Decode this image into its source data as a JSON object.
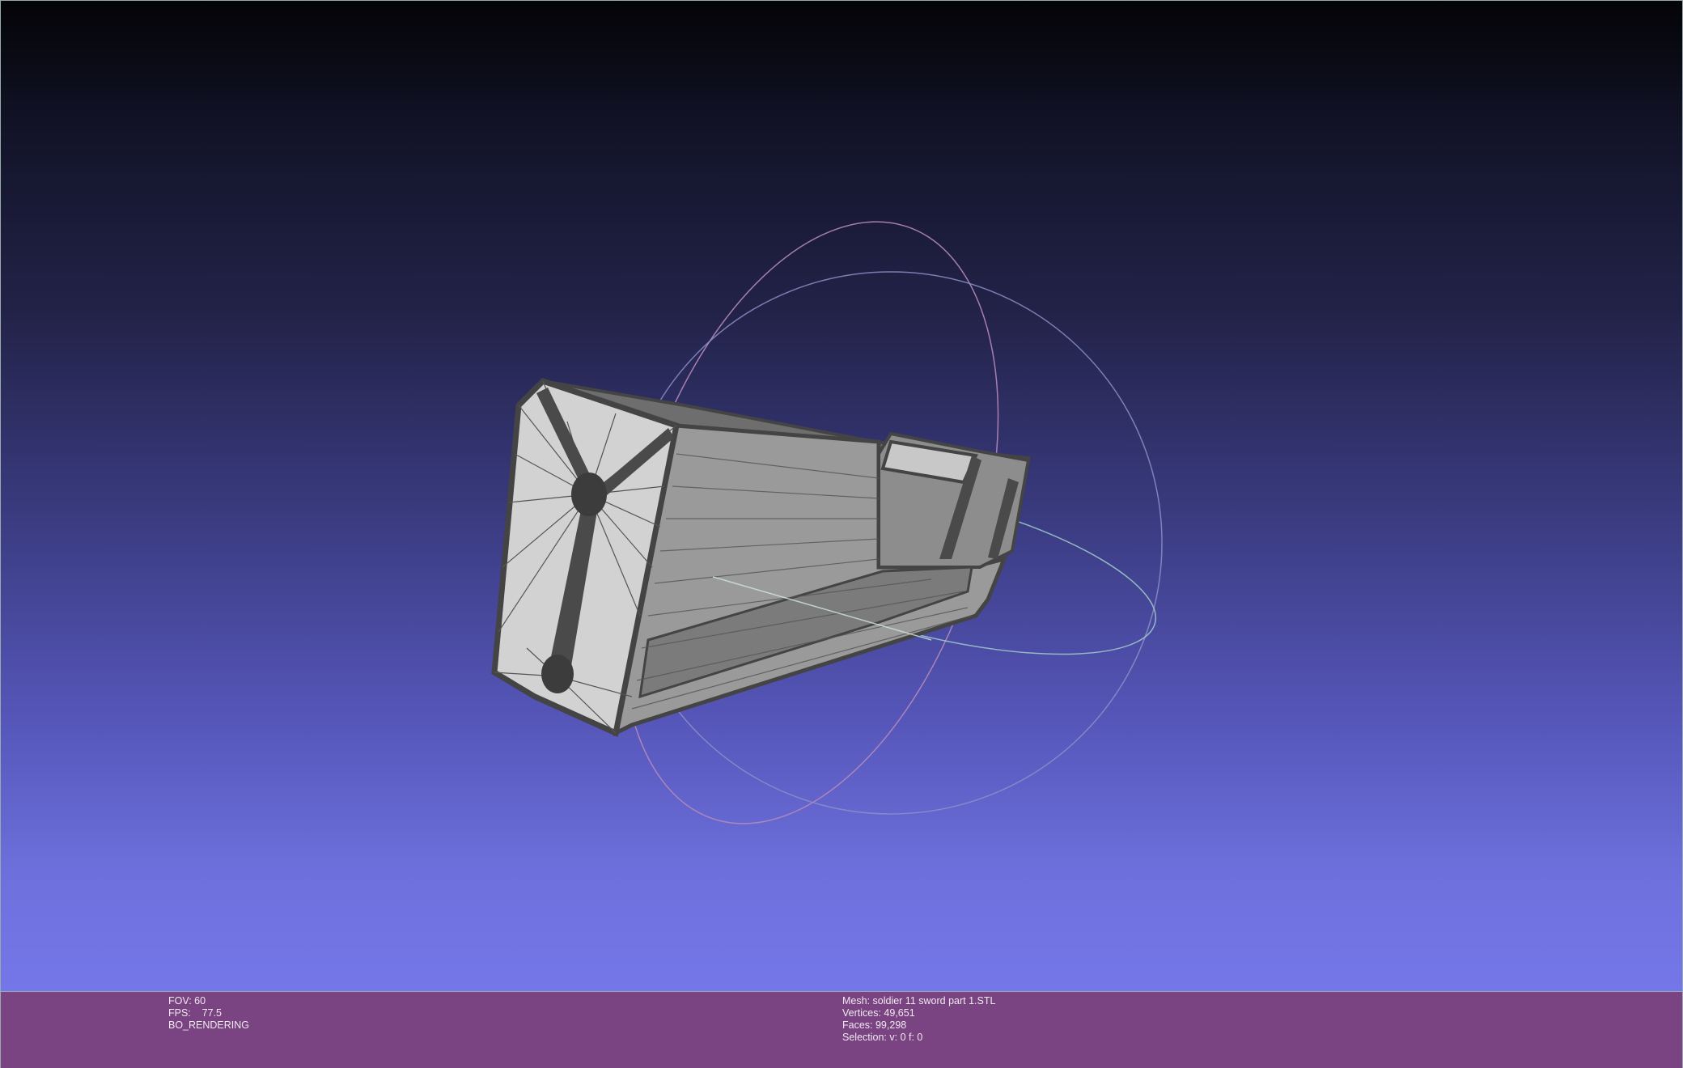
{
  "left_info": {
    "fov": "FOV: 60",
    "fps": "FPS:    77.5",
    "mode": "BO_RENDERING"
  },
  "right_info": {
    "mesh": "Mesh: soldier 11 sword part 1.STL",
    "vertices": "Vertices: 49,651",
    "faces": "Faces: 99,298",
    "selection": "Selection: v: 0 f: 0"
  },
  "colors": {
    "background_top": "#040407",
    "background_bottom": "#7477e8",
    "infobar": "#7a4482",
    "mesh_face_light": "#cfcfcf",
    "mesh_face_dark": "#8e8e8e",
    "mesh_edge": "#444444"
  },
  "icons": {
    "trackball": "trackball-icon"
  }
}
